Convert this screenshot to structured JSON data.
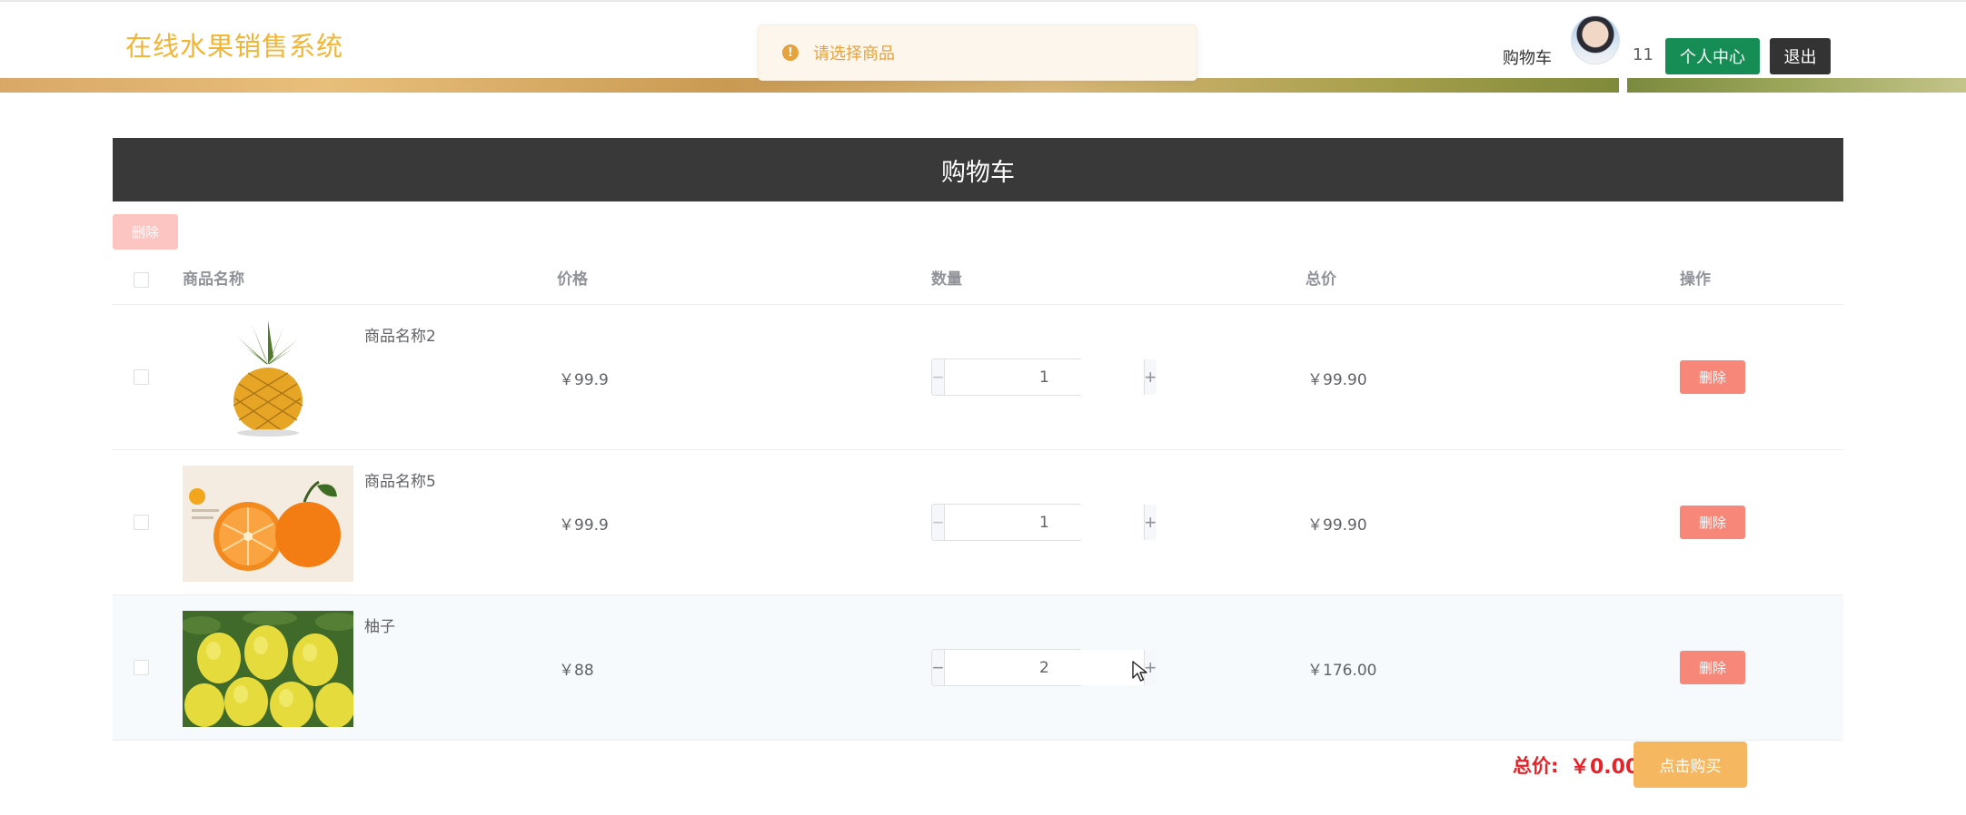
{
  "header": {
    "brand": "在线水果销售系统",
    "cart_link": "购物车",
    "cart_count": "11",
    "user_center": "个人中心",
    "logout": "退出"
  },
  "toast": {
    "message": "请选择商品",
    "icon": "warning-icon",
    "color": "#e6a23c"
  },
  "cart": {
    "title": "购物车",
    "batch_delete": "删除",
    "columns": {
      "name": "商品名称",
      "price": "价格",
      "quantity": "数量",
      "total": "总价",
      "action": "操作"
    },
    "items": [
      {
        "name": "商品名称2",
        "price": "￥99.9",
        "quantity": "1",
        "subtotal": "￥99.90",
        "delete": "删除",
        "image": "pineapple"
      },
      {
        "name": "商品名称5",
        "price": "￥99.9",
        "quantity": "1",
        "subtotal": "￥99.90",
        "delete": "删除",
        "image": "orange"
      },
      {
        "name": "柚子",
        "price": "￥88",
        "quantity": "2",
        "subtotal": "￥176.00",
        "delete": "删除",
        "image": "pomelo"
      }
    ],
    "total_label": "总价:",
    "total_value": "￥0.00",
    "buy_button": "点击购买"
  },
  "colors": {
    "brand": "#f2b535",
    "user_center_button": "#158d55",
    "delete_button": "#f78879",
    "buy_button": "#f5b860",
    "total_text": "#e4242a"
  }
}
